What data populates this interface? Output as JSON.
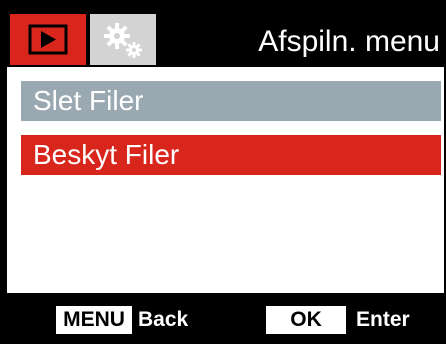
{
  "colors": {
    "accent_red": "#d9261c",
    "unselected_gray": "#9aa8b1",
    "tab_inactive": "#d3d3d3",
    "background": "#000000",
    "panel": "#ffffff"
  },
  "header": {
    "title": "Afspiln. menu",
    "tabs": [
      {
        "icon": "playback-icon",
        "active": true
      },
      {
        "icon": "settings-gears-icon",
        "active": false
      }
    ]
  },
  "menu": {
    "items": [
      {
        "label": "Slet Filer",
        "selected": false
      },
      {
        "label": "Beskyt Filer",
        "selected": true
      }
    ]
  },
  "footer": {
    "menu_key": "MENU",
    "menu_action": "Back",
    "ok_key": "OK",
    "ok_action": "Enter"
  }
}
